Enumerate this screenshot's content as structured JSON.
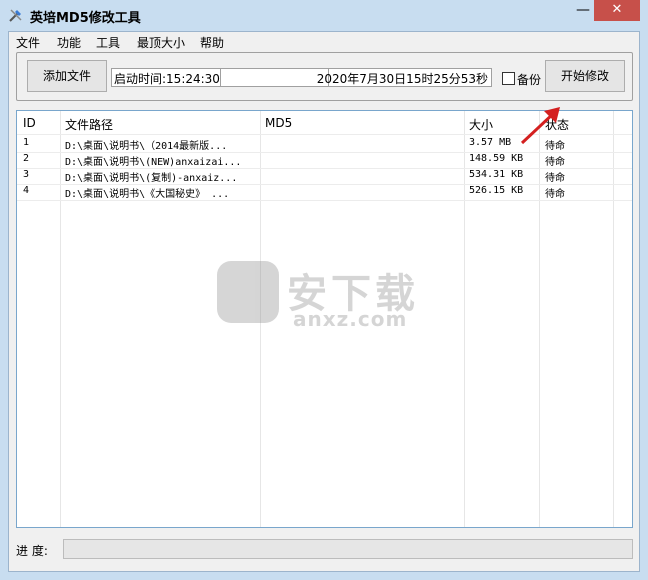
{
  "window": {
    "title": "英培MD5修改工具",
    "minimize": "—",
    "close": "✕"
  },
  "menu": [
    "文件",
    "功能",
    "工具",
    "最顶大小",
    "帮助"
  ],
  "toolbar": {
    "add_file_label": "添加文件",
    "start_time": "启动时间:15:24:30",
    "current_time": "2020年7月30日15时25分53秒",
    "backup_label": "备份",
    "backup_checked": false,
    "start_label": "开始修改"
  },
  "list": {
    "columns": [
      "ID",
      "文件路径",
      "MD5",
      "大小",
      "状态"
    ],
    "rows": [
      {
        "id": "1",
        "path": "D:\\桌面\\说明书\\（2014最新版...",
        "md5": "",
        "size": "3.57 MB",
        "status": "待命"
      },
      {
        "id": "2",
        "path": "D:\\桌面\\说明书\\(NEW)anxaizai...",
        "md5": "",
        "size": "148.59 KB",
        "status": "待命"
      },
      {
        "id": "3",
        "path": "D:\\桌面\\说明书\\(复制)-anxaiz...",
        "md5": "",
        "size": "534.31 KB",
        "status": "待命"
      },
      {
        "id": "4",
        "path": "D:\\桌面\\说明书\\《大国秘史》 ...",
        "md5": "",
        "size": "526.15 KB",
        "status": "待命"
      }
    ]
  },
  "progress": {
    "label": "进 度:",
    "value": 0
  },
  "watermark": {
    "text": "安下载",
    "sub": "anxz.com"
  }
}
